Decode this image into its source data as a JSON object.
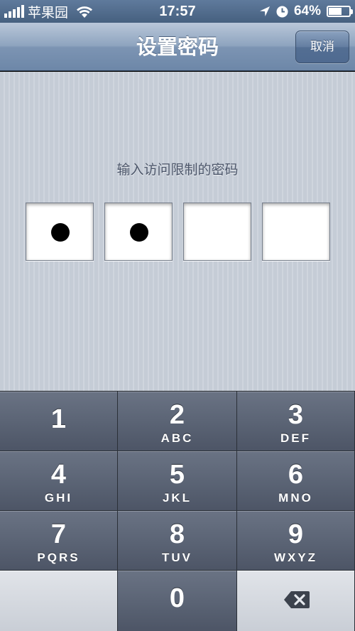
{
  "status_bar": {
    "carrier": "苹果园",
    "time": "17:57",
    "battery_text": "64%",
    "battery_level": 0.64,
    "icons": [
      "signal-icon",
      "wifi-icon",
      "location-icon",
      "clock-icon",
      "battery-icon"
    ]
  },
  "nav": {
    "title": "设置密码",
    "cancel_label": "取消"
  },
  "passcode": {
    "prompt": "输入访问限制的密码",
    "length": 4,
    "filled": 2
  },
  "keypad": {
    "keys": [
      {
        "digit": "1",
        "letters": ""
      },
      {
        "digit": "2",
        "letters": "ABC"
      },
      {
        "digit": "3",
        "letters": "DEF"
      },
      {
        "digit": "4",
        "letters": "GHI"
      },
      {
        "digit": "5",
        "letters": "JKL"
      },
      {
        "digit": "6",
        "letters": "MNO"
      },
      {
        "digit": "7",
        "letters": "PQRS"
      },
      {
        "digit": "8",
        "letters": "TUV"
      },
      {
        "digit": "9",
        "letters": "WXYZ"
      },
      {
        "digit": "0",
        "letters": ""
      }
    ],
    "delete_icon": "backspace-icon"
  },
  "colors": {
    "nav_top": "#b9c7d9",
    "nav_bottom": "#6d87a8",
    "background": "#c5ccd6",
    "key": "#5a6374",
    "key_light": "#d5d9df",
    "prompt_text": "#4c566a"
  }
}
